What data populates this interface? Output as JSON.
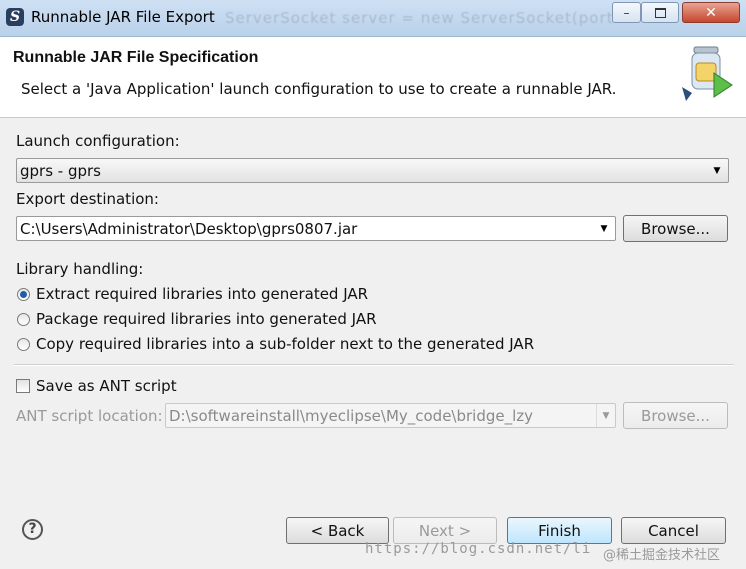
{
  "window": {
    "title": "Runnable JAR File Export",
    "background_text": "ServerSocket server = new ServerSocket(port"
  },
  "header": {
    "title": "Runnable JAR File Specification",
    "description": "Select a 'Java Application' launch configuration to use to create a runnable JAR."
  },
  "launch": {
    "label": "Launch configuration:",
    "value": "gprs - gprs"
  },
  "export": {
    "label": "Export destination:",
    "value": "C:\\Users\\Administrator\\Desktop\\gprs0807.jar",
    "browse_label": "Browse..."
  },
  "library": {
    "label": "Library handling:",
    "options": [
      {
        "label": "Extract required libraries into generated JAR",
        "checked": true
      },
      {
        "label": "Package required libraries into generated JAR",
        "checked": false
      },
      {
        "label": "Copy required libraries into a sub-folder next to the generated JAR",
        "checked": false
      }
    ]
  },
  "ant": {
    "checkbox_label": "Save as ANT script",
    "checked": false,
    "location_label": "ANT script location:",
    "location_value": "D:\\softwareinstall\\myeclipse\\My_code\\bridge_lzy",
    "browse_label": "Browse..."
  },
  "footer": {
    "help_label": "?",
    "back_label": "< Back",
    "next_label": "Next >",
    "finish_label": "Finish",
    "cancel_label": "Cancel"
  },
  "watermark": {
    "url": "https://blog.csdn.net/li",
    "text": "@稀土掘金技术社区"
  },
  "icons": {
    "app": "eclipse-icon",
    "wizard": "jar-export-icon",
    "minimize": "minimize-icon",
    "maximize": "maximize-icon",
    "close": "close-icon",
    "help": "help-icon",
    "dropdown": "chevron-down-icon"
  },
  "colors": {
    "titlebar": "#b9d1ea",
    "default_button": "#bee6fd",
    "radio_selected": "#1e5ea8"
  }
}
